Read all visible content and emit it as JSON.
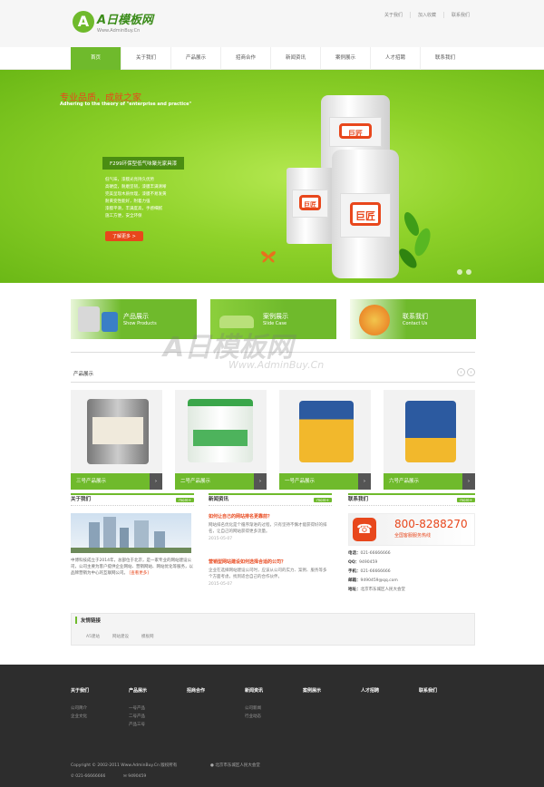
{
  "header": {
    "logo_letter": "A",
    "logo_name": "A日模板网",
    "logo_url": "Www.AdminBuy.Cn",
    "top_links": [
      "关于我们",
      "加入收藏",
      "联系我们"
    ]
  },
  "nav": {
    "items": [
      "首页",
      "关于我们",
      "产品展示",
      "招商合作",
      "新闻资讯",
      "案例展示",
      "人才招聘",
      "联系我们"
    ],
    "active": "首页"
  },
  "banner": {
    "headline": "专业品质，成就之家",
    "subtitle": "Adhering to the theory of \"enterprise and practice\"",
    "tag": "F299环保型低气味聚光家具漆",
    "bullets": [
      "低气味，漆膜光亮持久优势",
      "高硬度，耐磨坚韧，漆膜丰满清晰",
      "完美呈现木质纹理，漆膜不易发黄",
      "耐黄变性能好，附着力强",
      "漆膜平滑，丰满度高，手感细腻",
      "施工方便，安全环保"
    ],
    "more_button": "了解更多 >",
    "can_label": "巨匠"
  },
  "features": [
    {
      "title": "产品展示",
      "sub": "Show Products",
      "color": "#6fba2c"
    },
    {
      "title": "案例展示",
      "sub": "Slide Case",
      "color": "#6fba2c"
    },
    {
      "title": "联系我们",
      "sub": "Contact Us",
      "color": "#6fba2c"
    }
  ],
  "products": {
    "heading": "产品展示",
    "prev": "‹",
    "next": "›",
    "items": [
      {
        "caption": "三号产品展示",
        "arrow": "›"
      },
      {
        "caption": "二号产品展示",
        "arrow": "›"
      },
      {
        "caption": "一号产品展示",
        "arrow": "›"
      },
      {
        "caption": "六号产品展示",
        "arrow": "›"
      }
    ]
  },
  "about": {
    "heading": "关于我们",
    "more": "more+",
    "text": "中博科技成立于2014年，总部位于北京，是一家专业的网站建设公司，公司主要为客户提供企业网站、营销网站、网站优化等服务，以品牌营销为中心的互联网公司。",
    "link": "[查看更多]"
  },
  "news": {
    "heading": "新闻资讯",
    "more": "more+",
    "items": [
      {
        "title": "如何让自己的网站排名更靠前？",
        "desc": "网站排名优化是个循序渐进的过程，只有坚持不懈才能获得好的排名，让自己的网站获得更多流量。",
        "date": "2015-05-07"
      },
      {
        "title": "营销型网站建设如何选择合适的公司？",
        "desc": "企业在选择网站建设公司时，应该从公司的实力、案例、服务等多个方面考虑，找到适合自己的合作伙伴。",
        "date": "2015-05-07"
      }
    ]
  },
  "contact": {
    "heading": "联系我们",
    "more": "more+",
    "hotline": "800-8288270",
    "hotline_note": "全国客服服务热线",
    "rows": [
      {
        "k": "电话：",
        "v": "021-66666666"
      },
      {
        "k": "QQ：",
        "v": "9490459"
      },
      {
        "k": "手机：",
        "v": "021-66666666"
      },
      {
        "k": "邮箱：",
        "v": "9490459@qq.com"
      },
      {
        "k": "地址：",
        "v": "北京市东城区人民大会堂"
      }
    ]
  },
  "links": {
    "heading": "友情链接",
    "items": [
      "A5建站",
      "网站建设",
      "模板网"
    ]
  },
  "footer": {
    "cols": [
      {
        "h": "关于我们",
        "items": [
          "公司简介",
          "企业文化"
        ]
      },
      {
        "h": "产品展示",
        "items": [
          "一号产品",
          "二号产品",
          "产品三号"
        ]
      },
      {
        "h": "招商合作",
        "items": []
      },
      {
        "h": "新闻资讯",
        "items": [
          "公司新闻",
          "行业动态"
        ]
      },
      {
        "h": "案例展示",
        "items": []
      },
      {
        "h": "人才招聘",
        "items": []
      },
      {
        "h": "联系我们",
        "items": []
      }
    ],
    "copyright": "Copyright © 2002-2011 Www.AdminBuy.Cn 版权所有",
    "address": "北京市东城区人民大会堂",
    "phone": "021-66666666",
    "qq": "9490459"
  },
  "watermark": {
    "main": "A日模板网",
    "sub": "Www.AdminBuy.Cn"
  },
  "colors": {
    "accent": "#6fba2c",
    "highlight": "#e8471c",
    "footer": "#2d2d2d"
  }
}
